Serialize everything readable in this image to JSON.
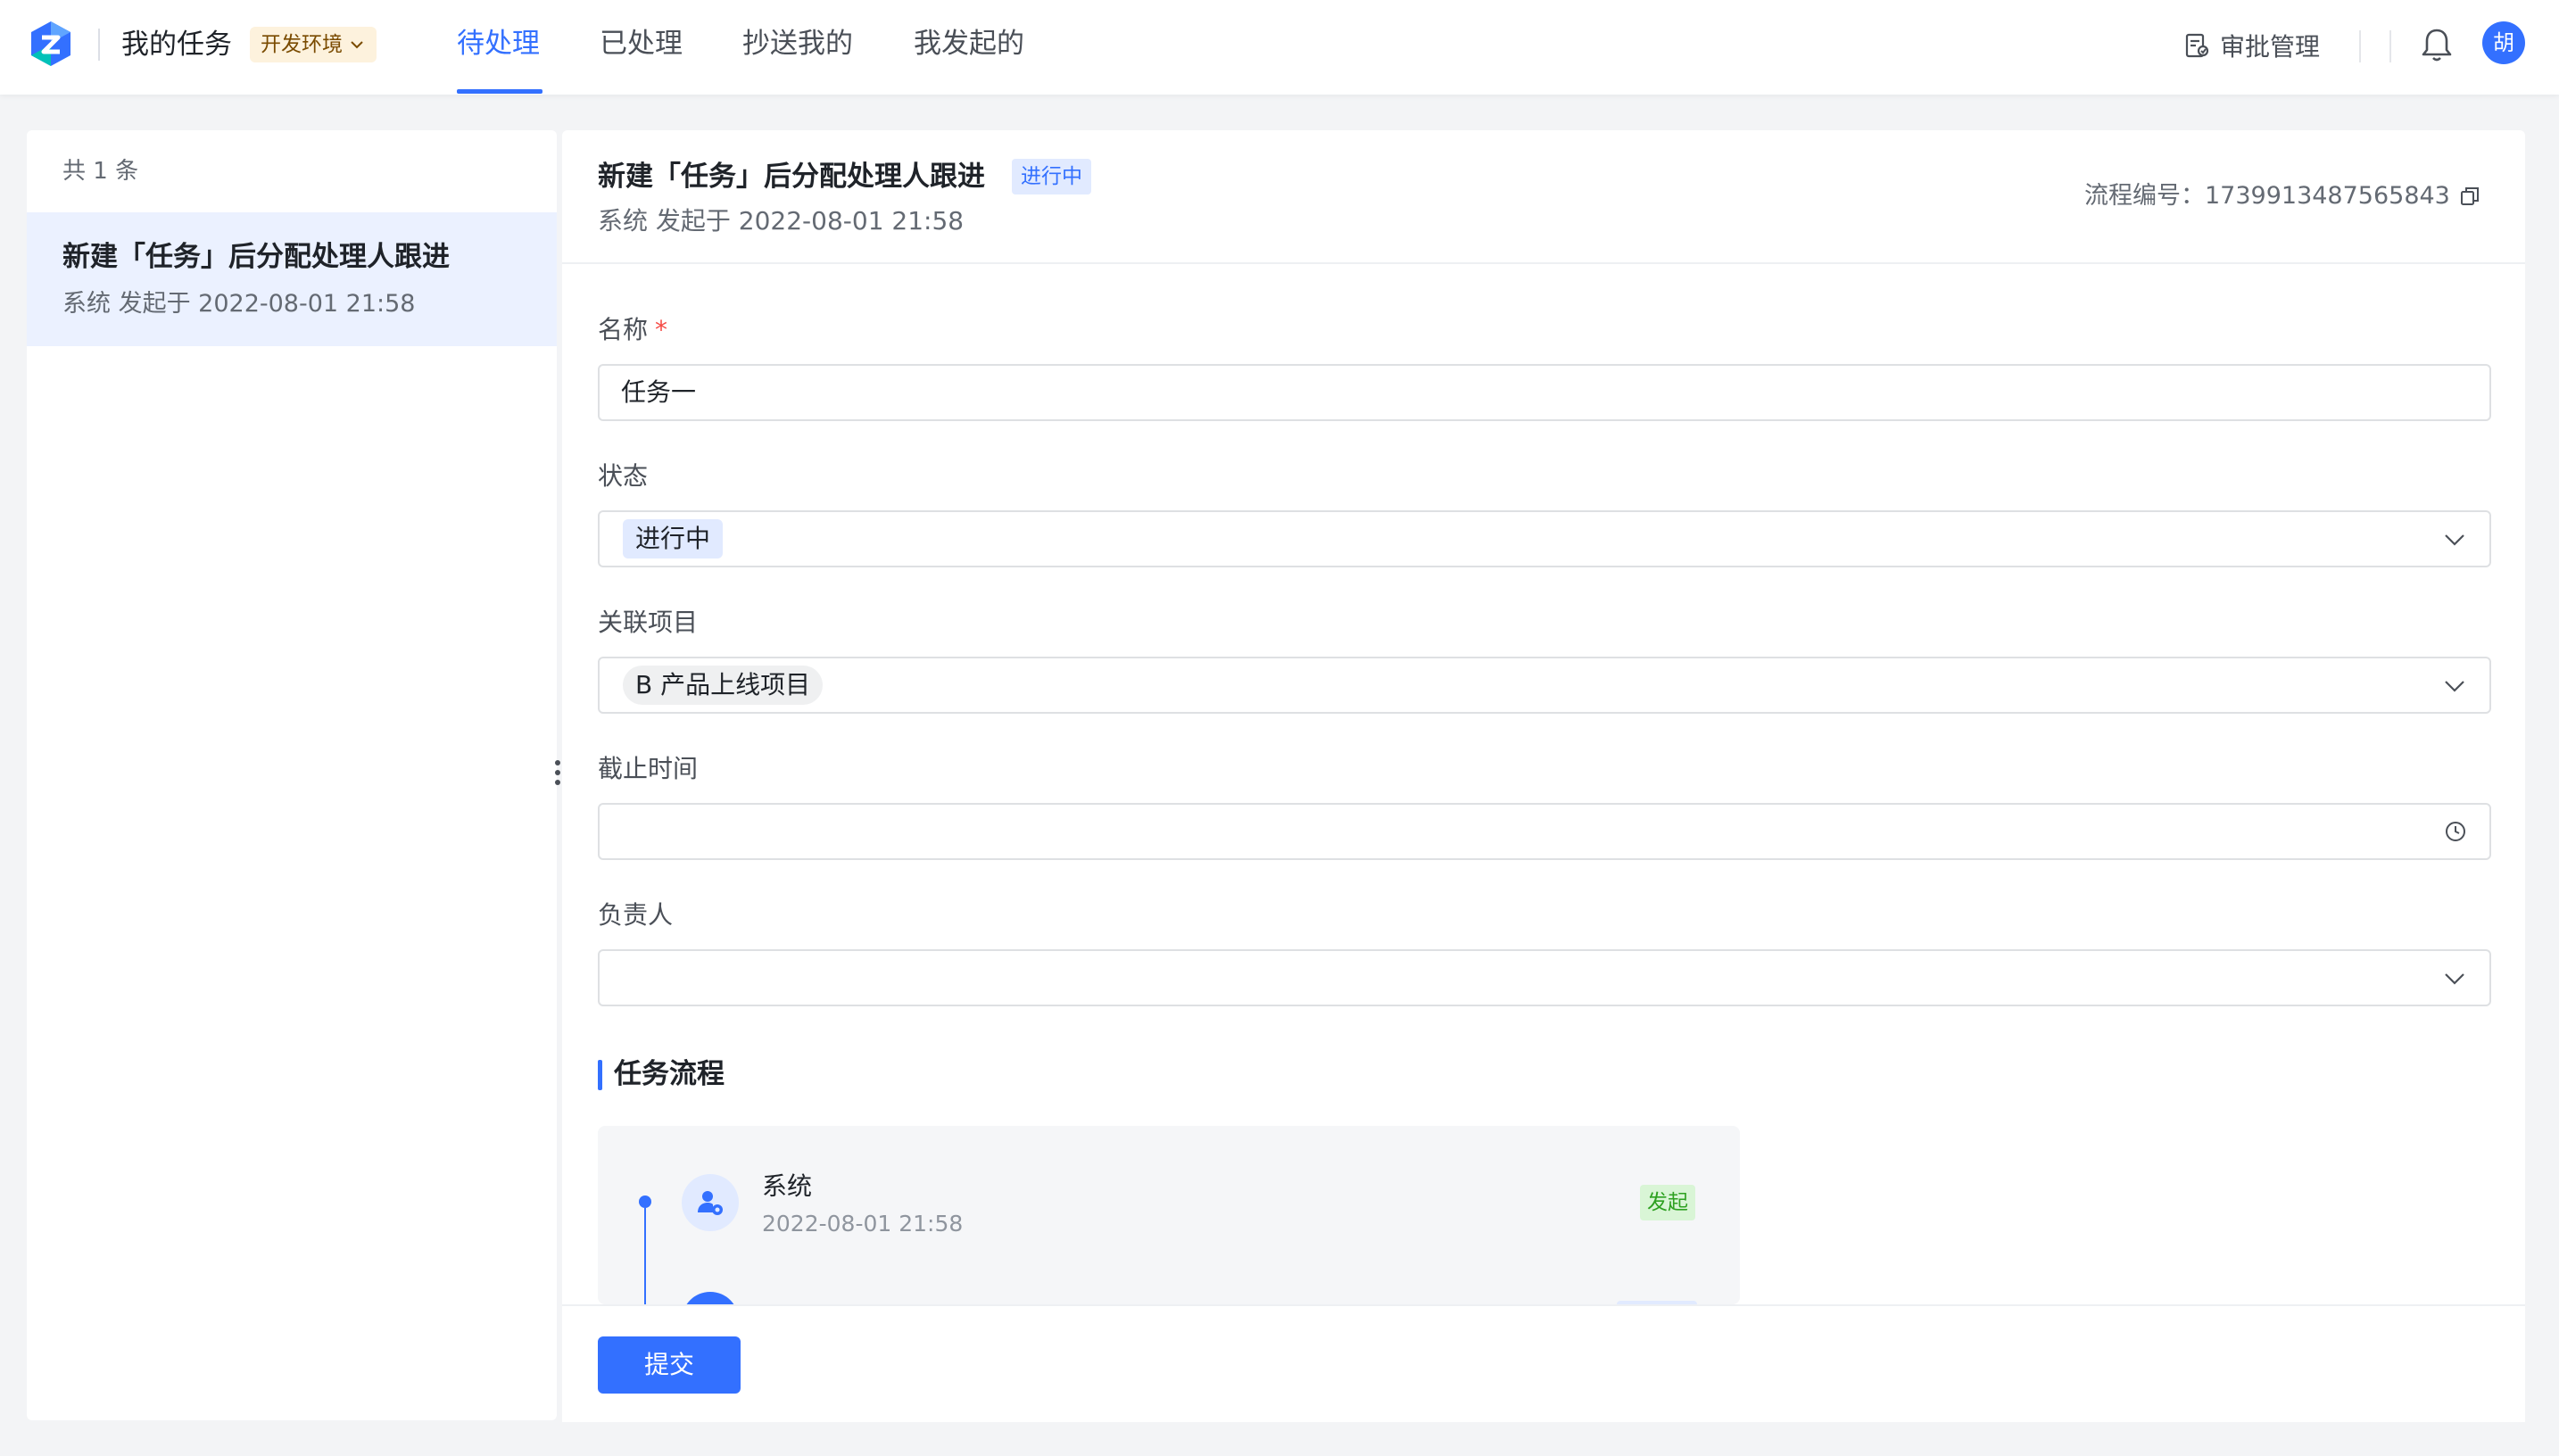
{
  "header": {
    "app_title": "我的任务",
    "env_label": "开发环境",
    "tabs": [
      {
        "label": "待处理",
        "active": true
      },
      {
        "label": "已处理",
        "active": false
      },
      {
        "label": "抄送我的",
        "active": false
      },
      {
        "label": "我发起的",
        "active": false
      }
    ],
    "approval_management": "审批管理",
    "avatar_text": "胡",
    "accent_color": "#3370ff"
  },
  "list": {
    "count_text": "共 1 条",
    "items": [
      {
        "title": "新建「任务」后分配处理人跟进",
        "subtitle": "系统 发起于 2022-08-01 21:58"
      }
    ]
  },
  "detail": {
    "title": "新建「任务」后分配处理人跟进",
    "status": "进行中",
    "subtitle": "系统 发起于 2022-08-01 21:58",
    "flow_number_label": "流程编号：",
    "flow_number": "1739913487565843",
    "form": {
      "name_label": "名称",
      "required_mark": "*",
      "name_value": "任务一",
      "status_label": "状态",
      "status_value": "进行中",
      "project_label": "关联项目",
      "project_value": "B 产品上线项目",
      "deadline_label": "截止时间",
      "owner_label": "负责人"
    },
    "flow_section_title": "任务流程",
    "flow_nodes": [
      {
        "name": "系统",
        "time": "2022-08-01 21:58",
        "tag": "发起"
      }
    ],
    "submit_label": "提交"
  }
}
